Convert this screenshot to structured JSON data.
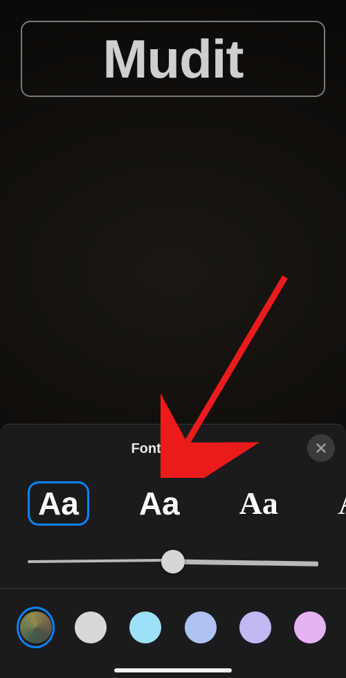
{
  "display_text": "Mudit",
  "sheet": {
    "title": "Font & Color",
    "close_label": "Close"
  },
  "fonts": [
    {
      "sample": "Aa",
      "class": "f1",
      "selected": true
    },
    {
      "sample": "Aa",
      "class": "f2",
      "selected": false
    },
    {
      "sample": "Aa",
      "class": "f3",
      "selected": false
    },
    {
      "sample": "Aa",
      "class": "f4",
      "selected": false
    }
  ],
  "slider": {
    "value": 50,
    "min": 0,
    "max": 100
  },
  "colors": [
    {
      "id": "dynamic",
      "css": "gradient",
      "selected": true
    },
    {
      "id": "white",
      "hex": "#d8d8d8",
      "selected": false
    },
    {
      "id": "cyan",
      "hex": "#9be2f6",
      "selected": false
    },
    {
      "id": "periwinkle",
      "hex": "#aec2f4",
      "selected": false
    },
    {
      "id": "lavender",
      "hex": "#c3b7f2",
      "selected": false
    },
    {
      "id": "pink",
      "hex": "#e6b3f2",
      "selected": false
    }
  ]
}
